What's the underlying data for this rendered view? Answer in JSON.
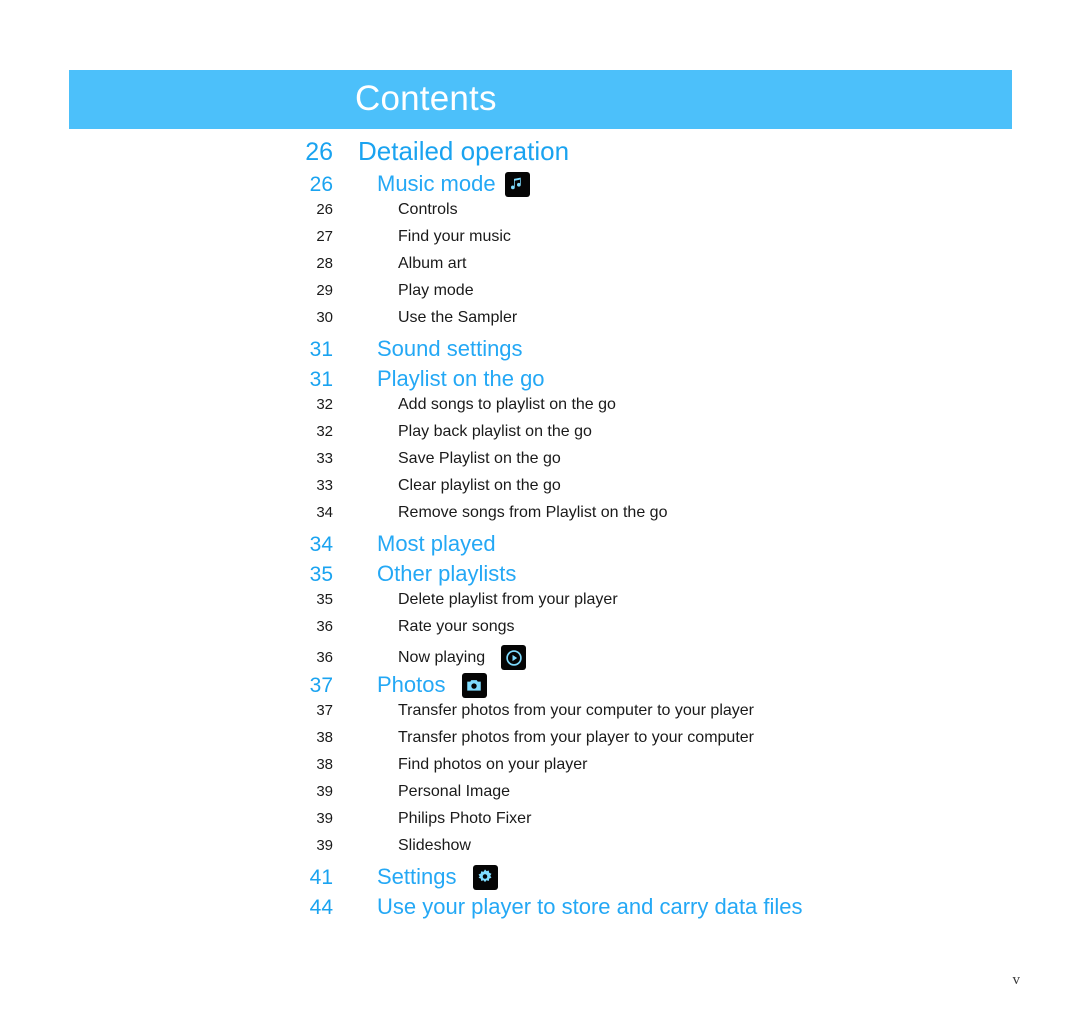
{
  "page": {
    "title": "Contents",
    "footer_page_number": "v",
    "banner_color": "#4cc0fa",
    "heading_color": "#1aa3f0",
    "subheading_color": "#24a8f5",
    "body_color": "#1a1a1a"
  },
  "toc": {
    "entries": [
      {
        "level": 1,
        "page": "26",
        "label": "Detailed operation",
        "icon": null
      },
      {
        "level": 2,
        "page": "26",
        "label": "Music mode",
        "icon": "music-note-icon"
      },
      {
        "level": 3,
        "page": "26",
        "label": "Controls",
        "icon": null
      },
      {
        "level": 3,
        "page": "27",
        "label": "Find your music",
        "icon": null
      },
      {
        "level": 3,
        "page": "28",
        "label": "Album art",
        "icon": null
      },
      {
        "level": 3,
        "page": "29",
        "label": "Play mode",
        "icon": null
      },
      {
        "level": 3,
        "page": "30",
        "label": "Use the Sampler",
        "icon": null
      },
      {
        "level": 2,
        "page": "31",
        "label": "Sound settings",
        "icon": null
      },
      {
        "level": 2,
        "page": "31",
        "label": "Playlist on the go",
        "icon": null
      },
      {
        "level": 3,
        "page": "32",
        "label": "Add songs to playlist on the go",
        "icon": null
      },
      {
        "level": 3,
        "page": "32",
        "label": "Play back playlist on the go",
        "icon": null
      },
      {
        "level": 3,
        "page": "33",
        "label": "Save Playlist on the go",
        "icon": null
      },
      {
        "level": 3,
        "page": "33",
        "label": "Clear playlist on the go",
        "icon": null
      },
      {
        "level": 3,
        "page": "34",
        "label": "Remove songs from Playlist on the go",
        "icon": null
      },
      {
        "level": 2,
        "page": "34",
        "label": "Most played",
        "icon": null
      },
      {
        "level": 2,
        "page": "35",
        "label": "Other playlists",
        "icon": null
      },
      {
        "level": 3,
        "page": "35",
        "label": "Delete playlist from your player",
        "icon": null
      },
      {
        "level": 3,
        "page": "36",
        "label": "Rate your songs",
        "icon": null
      },
      {
        "level": 3,
        "page": "36",
        "label": "Now playing",
        "icon": "play-circle-icon"
      },
      {
        "level": 2,
        "page": "37",
        "label": "Photos",
        "icon": "camera-icon"
      },
      {
        "level": 3,
        "page": "37",
        "label": "Transfer photos from your computer to your player",
        "icon": null
      },
      {
        "level": 3,
        "page": "38",
        "label": "Transfer photos from your player to your computer",
        "icon": null
      },
      {
        "level": 3,
        "page": "38",
        "label": "Find photos on your player",
        "icon": null
      },
      {
        "level": 3,
        "page": "39",
        "label": "Personal Image",
        "icon": null
      },
      {
        "level": 3,
        "page": "39",
        "label": "Philips Photo Fixer",
        "icon": null
      },
      {
        "level": 3,
        "page": "39",
        "label": "Slideshow",
        "icon": null
      },
      {
        "level": 2,
        "page": "41",
        "label": "Settings",
        "icon": "gear-icon"
      },
      {
        "level": 2,
        "page": "44",
        "label": "Use your player to store and carry data files",
        "icon": null
      }
    ]
  }
}
